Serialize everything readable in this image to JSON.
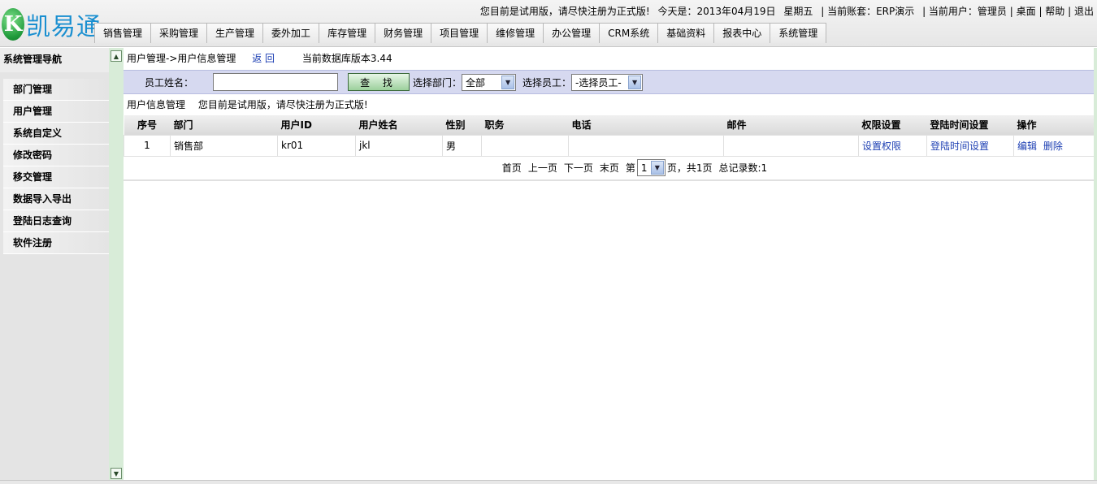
{
  "brand": {
    "logo_letter": "K",
    "logo_text": "凯易通"
  },
  "topinfo": {
    "trial_notice": "您目前是试用版，请尽快注册为正式版!",
    "today": "今天是：2013年04月19日",
    "weekday": "星期五",
    "account": "| 当前账套：ERP演示",
    "user": "| 当前用户：管理员",
    "desktop": "| 桌面",
    "help": "| 帮助",
    "logout": "| 退出"
  },
  "nav": [
    "销售管理",
    "采购管理",
    "生产管理",
    "委外加工",
    "库存管理",
    "财务管理",
    "项目管理",
    "维修管理",
    "办公管理",
    "CRM系统",
    "基础资料",
    "报表中心",
    "系统管理"
  ],
  "sidebar": {
    "title": "系统管理导航",
    "items": [
      "部门管理",
      "用户管理",
      "系统自定义",
      "修改密码",
      "移交管理",
      "数据导入导出",
      "登陆日志查询",
      "软件注册"
    ]
  },
  "main": {
    "breadcrumb": "用户管理->用户信息管理",
    "back": "返 回",
    "version": "当前数据库版本3.44",
    "search": {
      "name_label": "员工姓名：",
      "name_value": "",
      "button": "查 找",
      "dept_label": "选择部门：",
      "dept_value": "全部",
      "emp_label": "选择员工：",
      "emp_value": "-选择员工-"
    },
    "subtitle": "用户信息管理",
    "notice": "您目前是试用版，请尽快注册为正式版!",
    "table": {
      "columns": [
        "序号",
        "部门",
        "用户ID",
        "用户姓名",
        "性别",
        "职务",
        "电话",
        "邮件",
        "权限设置",
        "登陆时间设置",
        "操作"
      ],
      "rows": [
        {
          "no": "1",
          "dept": "销售部",
          "uid": "kr01",
          "name": "jkl",
          "gender": "男",
          "title": "",
          "phone": "",
          "email": "",
          "perm": "设置权限",
          "logintime": "登陆时间设置",
          "edit": "编辑",
          "del": "删除"
        }
      ]
    },
    "pager": {
      "first": "首页",
      "prev": "上一页",
      "next": "下一页",
      "last": "末页",
      "page_prefix": "第",
      "page_value": "1",
      "page_suffix": "页，共1页",
      "total": "总记录数:1"
    }
  },
  "colors": {
    "accent_blue": "#1d3fb3",
    "search_bg": "#d6d9f0",
    "splitter": "#d8ecd8"
  }
}
